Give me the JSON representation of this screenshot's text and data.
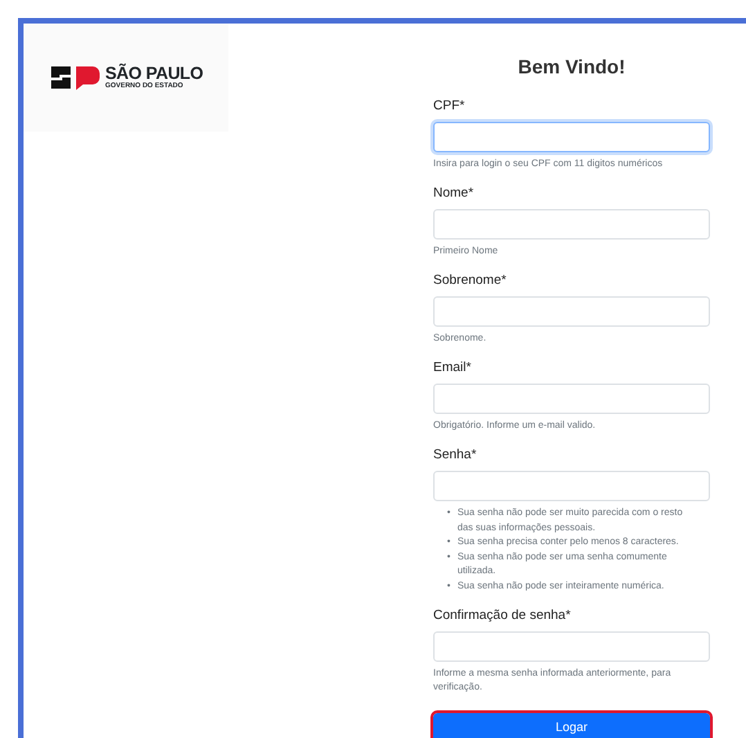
{
  "logo": {
    "name": "SÃO PAULO",
    "subtitle": "GOVERNO DO ESTADO"
  },
  "title": "Bem Vindo!",
  "fields": [
    {
      "label": "CPF*",
      "focused": true,
      "help": "Insira para login o seu CPF com 11 digitos numéricos"
    },
    {
      "label": "Nome*",
      "focused": false,
      "help": "Primeiro Nome"
    },
    {
      "label": "Sobrenome*",
      "focused": false,
      "help": "Sobrenome."
    },
    {
      "label": "Email*",
      "focused": false,
      "help": "Obrigatório. Informe um e-mail valido."
    },
    {
      "label": "Senha*",
      "focused": false,
      "bullet": "•",
      "rules": [
        "Sua senha não pode ser muito parecida com o resto das suas informações pessoais.",
        "Sua senha precisa conter pelo menos 8 caracteres.",
        "Sua senha não pode ser uma senha comumente utilizada.",
        "Sua senha não pode ser inteiramente numérica."
      ]
    },
    {
      "label": "Confirmação de senha*",
      "focused": false,
      "help": "Informe a mesma senha informada anteriormente, para verificação."
    }
  ],
  "button": {
    "label": "Logar",
    "focused": true
  }
}
